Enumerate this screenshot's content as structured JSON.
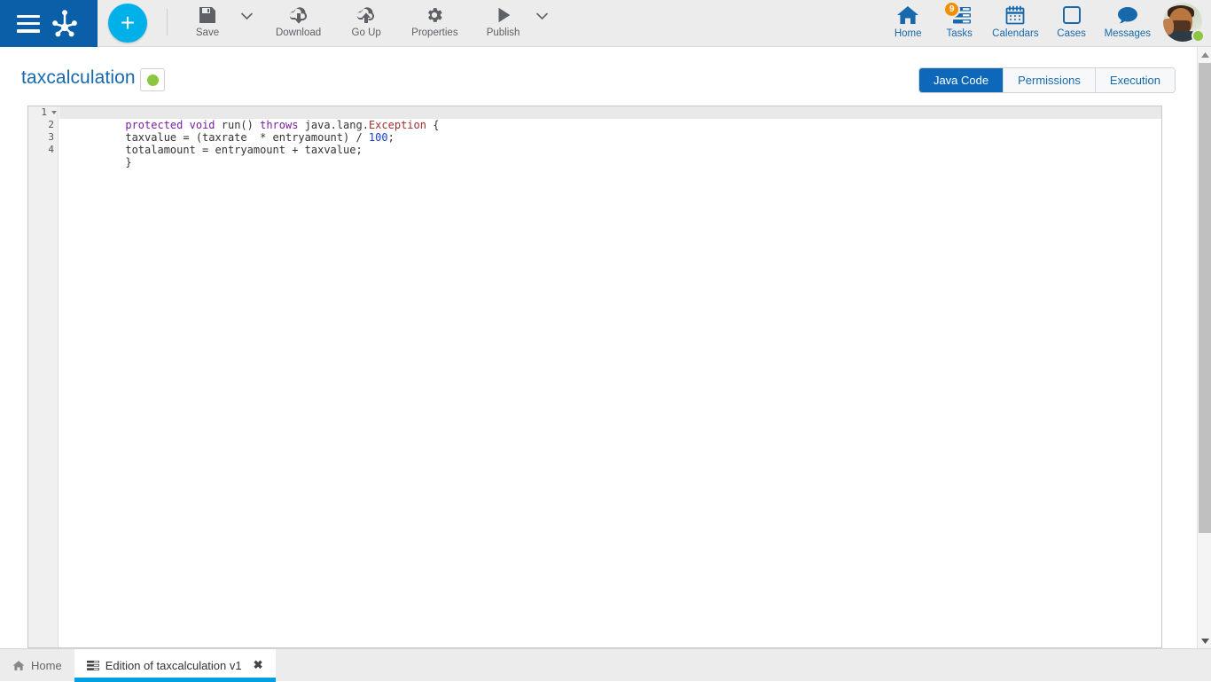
{
  "topbar": {
    "menu_icon": "hamburger-menu-icon",
    "logo_icon": "bonita-frog-logo",
    "add_button_label": "+",
    "tools": [
      {
        "label": "Save",
        "icon": "floppy-disk-icon",
        "has_caret": true
      },
      {
        "label": "Download",
        "icon": "cloud-download-icon",
        "has_caret": false
      },
      {
        "label": "Go Up",
        "icon": "cloud-upload-icon",
        "has_caret": false
      },
      {
        "label": "Properties",
        "icon": "gear-icon",
        "has_caret": false
      },
      {
        "label": "Publish",
        "icon": "play-triangle-icon",
        "has_caret": true
      }
    ],
    "nav": [
      {
        "label": "Home",
        "icon": "home-icon",
        "badge": ""
      },
      {
        "label": "Tasks",
        "icon": "tasks-list-icon",
        "badge": "9"
      },
      {
        "label": "Calendars",
        "icon": "calendar-icon",
        "badge": ""
      },
      {
        "label": "Cases",
        "icon": "square-outline-icon",
        "badge": ""
      },
      {
        "label": "Messages",
        "icon": "speech-bubble-icon",
        "badge": ""
      }
    ],
    "avatar": {
      "name": "user-avatar",
      "status": "online"
    }
  },
  "header": {
    "title": "taxcalculation",
    "state_indicator": "green-status-dot",
    "tabs": [
      {
        "label": "Java Code",
        "active": true
      },
      {
        "label": "Permissions",
        "active": false
      },
      {
        "label": "Execution",
        "active": false
      }
    ]
  },
  "editor": {
    "lines": [
      {
        "num": "1",
        "fold": true
      },
      {
        "num": "2",
        "fold": false
      },
      {
        "num": "3",
        "fold": false
      },
      {
        "num": "4",
        "fold": false
      }
    ],
    "code": {
      "l1_k1": "protected",
      "l1_k2": "void",
      "l1_run": " run() ",
      "l1_k3": "throws",
      "l1_type": " java.lang.",
      "l1_exc": "Exception",
      "l1_brace": " {",
      "l2": "taxvalue = (taxrate  * entryamount) / ",
      "l2_num": "100",
      "l2_end": ";",
      "l3": "totalamount = entryamount + taxvalue;",
      "l4": "}"
    }
  },
  "scrollbar": {
    "up_arrow": "scroll-up-arrow",
    "down_arrow": "scroll-down-arrow"
  },
  "taskbar": {
    "items": [
      {
        "label": "Home",
        "icon": "home-icon",
        "active": false,
        "closable": false
      },
      {
        "label": "Edition of taxcalculation v1",
        "icon": "editor-window-icon",
        "active": true,
        "closable": true,
        "close_glyph": "✖"
      }
    ]
  },
  "colors": {
    "brand_blue": "#0a5fa8",
    "accent_cyan": "#00b0e8",
    "link_blue": "#1769ac",
    "active_tab_blue": "#0d68ba",
    "status_green": "#8dc63f",
    "badge_orange": "#f09000"
  }
}
